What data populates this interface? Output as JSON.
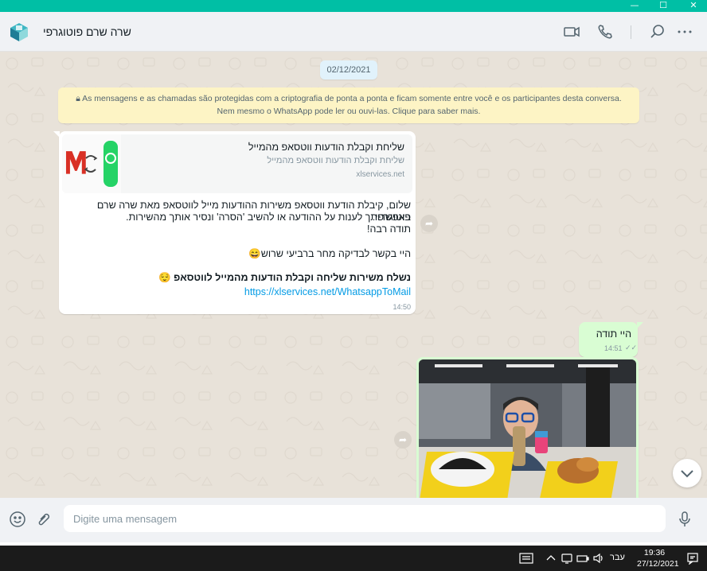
{
  "window": {
    "controls": [
      "—",
      "☐",
      "✕"
    ]
  },
  "header": {
    "contact_name": "שרה שרם פוטוגרפי",
    "icons": [
      "video-call-icon",
      "voice-call-icon",
      "search-icon",
      "more-options-icon"
    ]
  },
  "chat": {
    "date_label": "02/12/2021",
    "encryption_notice": "As mensagens e as chamadas são protegidas com a criptografia de ponta a ponta e ficam somente entre você e os participantes desta conversa. Nem mesmo o WhatsApp pode ler ou ouvi-las. Clique para saber mais.",
    "messages": [
      {
        "direction": "in",
        "link_preview": {
          "title": "שליחת וקבלת הודעות ווטסאפ מהמייל",
          "description": "שליחת וקבלת הודעות ווטסאפ מהמייל",
          "domain": "xlservices.net"
        },
        "lines": [
          "שלום, קיבלת הודעת ווטסאפ משירות ההודעות מייל לווטסאפ מאת שרה שרם פוטוגרפי.",
          "באפשרותך לענות על ההודעה או להשיב 'הסרה' ונסיר אותך מהשירות.",
          "תודה רבה!",
          "היי בקשר לבדיקה מחר ברביעי שרוש😄",
          "נשלח משירות שליחה וקבלת הודעות מהמייל לווטסאפ 😌"
        ],
        "link": "https://xlservices.net/WhatsappToMail",
        "time": "14:50"
      },
      {
        "direction": "out",
        "text": "היי תודה",
        "time": "14:51",
        "ticks": "✓✓"
      },
      {
        "direction": "out",
        "type": "photo"
      }
    ]
  },
  "composer": {
    "placeholder": "Digite uma mensagem"
  },
  "taskbar": {
    "lang": "עבר",
    "time": "19:36",
    "date": "27/12/2021"
  },
  "colors": {
    "accent": "#00bfa5",
    "outgoing": "#d9fdd3",
    "link": "#039be5",
    "banner": "#fdf4c5",
    "date_pill": "#e1f2fb"
  }
}
